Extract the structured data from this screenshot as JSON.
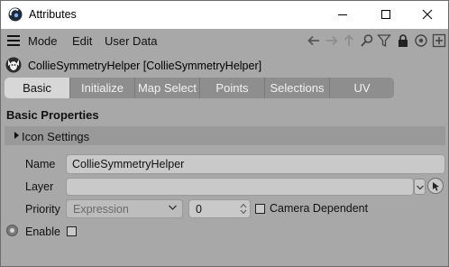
{
  "window": {
    "title": "Attributes",
    "controls": [
      "minimize-icon",
      "maximize-icon",
      "close-icon"
    ]
  },
  "menubar": {
    "items": [
      "Mode",
      "Edit",
      "User Data"
    ],
    "toolbar_icons": [
      "arrow-left-icon",
      "arrow-right-icon",
      "arrow-up-icon",
      "search-icon",
      "filter-icon",
      "lock-icon",
      "target-icon",
      "add-icon"
    ]
  },
  "object": {
    "name": "CollieSymmetryHelper [CollieSymmetryHelper]"
  },
  "tabs": [
    {
      "label": "Basic",
      "active": true
    },
    {
      "label": "Initialize",
      "active": false
    },
    {
      "label": "Map Select",
      "active": false
    },
    {
      "label": "Points",
      "active": false
    },
    {
      "label": "Selections",
      "active": false
    },
    {
      "label": "UV",
      "active": false
    }
  ],
  "section": {
    "title": "Basic Properties",
    "group": "Icon Settings"
  },
  "fields": {
    "name_label": "Name",
    "name_value": "CollieSymmetryHelper",
    "layer_label": "Layer",
    "layer_value": "",
    "priority_label": "Priority",
    "priority_mode": "Expression",
    "priority_value": "0",
    "camera_dependent_label": "Camera Dependent",
    "camera_dependent_checked": false,
    "enable_label": "Enable",
    "enable_checked": false
  },
  "colors": {
    "panel_bg": "#a8a8a8",
    "tab_active": "#d7d7d7",
    "tab_strip": "#8e8e8e",
    "field_bg": "#c9c9c9"
  }
}
